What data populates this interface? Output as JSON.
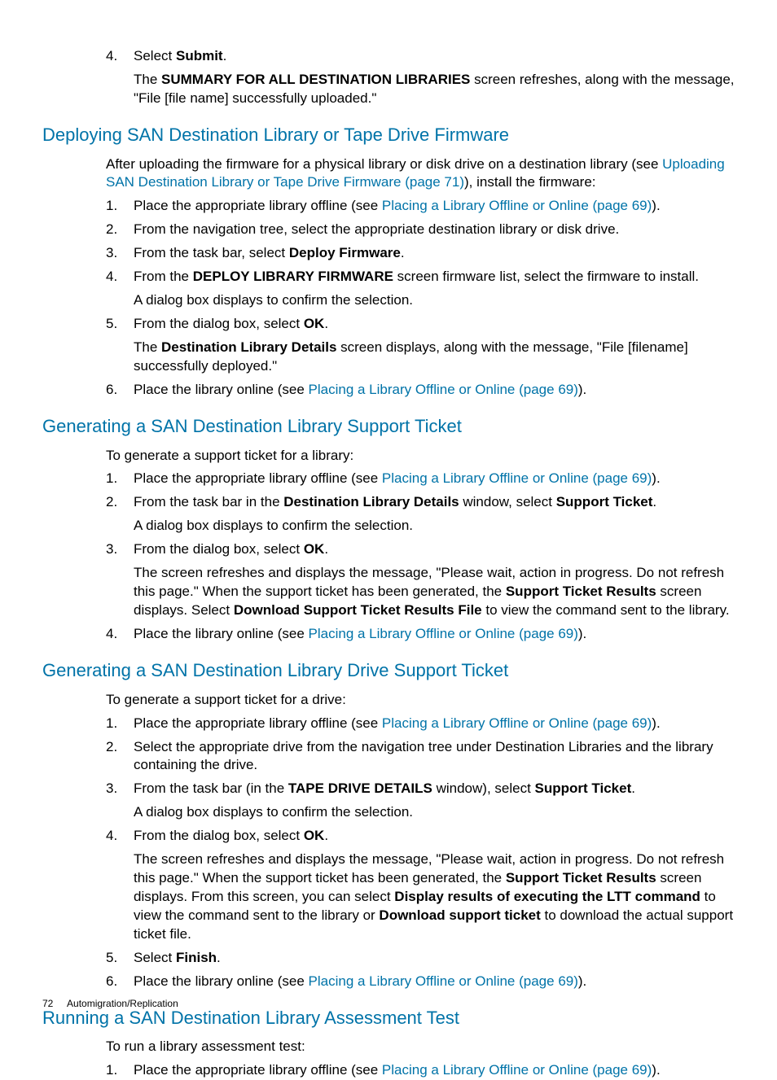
{
  "top_list": {
    "start": 4,
    "items": [
      {
        "text_parts": [
          "Select ",
          {
            "b": "Submit"
          },
          "."
        ],
        "sub": [
          "The ",
          {
            "b": "SUMMARY FOR ALL DESTINATION LIBRARIES"
          },
          " screen refreshes, along with the message, \"File [file name] successfully uploaded.\""
        ]
      }
    ]
  },
  "sections": [
    {
      "title": "Deploying SAN Destination Library or Tape Drive Firmware",
      "intro": [
        "After uploading the firmware for a physical library or disk drive on a destination library (see ",
        {
          "a": "Uploading SAN Destination Library or Tape Drive Firmware (page 71)"
        },
        "), install the firmware:"
      ],
      "items": [
        {
          "text_parts": [
            "Place the appropriate library offline (see ",
            {
              "a": "Placing a Library Offline or Online (page 69)"
            },
            ").",
            ""
          ]
        },
        {
          "text_parts": [
            "From the navigation tree, select the appropriate destination library or disk drive."
          ]
        },
        {
          "text_parts": [
            "From the task bar, select ",
            {
              "b": "Deploy Firmware"
            },
            "."
          ]
        },
        {
          "text_parts": [
            "From the ",
            {
              "b": "DEPLOY LIBRARY FIRMWARE"
            },
            " screen firmware list, select the firmware to install."
          ],
          "sub": [
            "A dialog box displays to confirm the selection."
          ]
        },
        {
          "text_parts": [
            "From the dialog box, select ",
            {
              "b": "OK"
            },
            "."
          ],
          "sub": [
            "The ",
            {
              "b": "Destination Library Details"
            },
            " screen displays, along with the message, \"File [filename] successfully deployed.\""
          ]
        },
        {
          "text_parts": [
            "Place the library online (see ",
            {
              "a": "Placing a Library Offline or Online (page 69)"
            },
            ").",
            ""
          ]
        }
      ]
    },
    {
      "title": "Generating a SAN Destination Library Support Ticket",
      "intro": [
        "To generate a support ticket for a library:"
      ],
      "items": [
        {
          "text_parts": [
            "Place the appropriate library offline (see ",
            {
              "a": "Placing a Library Offline or Online (page 69)"
            },
            ").",
            ""
          ]
        },
        {
          "text_parts": [
            "From the task bar in the ",
            {
              "b": "Destination Library Details"
            },
            " window, select ",
            {
              "b": "Support Ticket"
            },
            "."
          ],
          "sub": [
            "A dialog box displays to confirm the selection."
          ]
        },
        {
          "text_parts": [
            "From the dialog box, select ",
            {
              "b": "OK"
            },
            "."
          ],
          "sub": [
            "The screen refreshes and displays the message, \"Please wait, action in progress. Do not refresh this page.\" When the support ticket has been generated, the ",
            {
              "b": "Support Ticket Results"
            },
            " screen displays. Select ",
            {
              "b": "Download Support Ticket Results File"
            },
            " to view the command sent to the library."
          ]
        },
        {
          "text_parts": [
            "Place the library online (see ",
            {
              "a": "Placing a Library Offline or Online (page 69)"
            },
            ").",
            ""
          ]
        }
      ]
    },
    {
      "title": "Generating a SAN Destination Library Drive Support Ticket",
      "intro": [
        "To generate a support ticket for a drive:"
      ],
      "items": [
        {
          "text_parts": [
            "Place the appropriate library offline (see ",
            {
              "a": "Placing a Library Offline or Online (page 69)"
            },
            ").",
            ""
          ]
        },
        {
          "text_parts": [
            "Select the appropriate drive from the navigation tree under Destination Libraries and the library containing the drive."
          ]
        },
        {
          "text_parts": [
            "From the task bar (in the ",
            {
              "b": "TAPE DRIVE DETAILS"
            },
            " window), select ",
            {
              "b": "Support Ticket"
            },
            "."
          ],
          "sub": [
            "A dialog box displays to confirm the selection."
          ]
        },
        {
          "text_parts": [
            "From the dialog box, select ",
            {
              "b": "OK"
            },
            "."
          ],
          "sub": [
            "The screen refreshes and displays the message, \"Please wait, action in progress. Do not refresh this page.\" When the support ticket has been generated, the ",
            {
              "b": "Support Ticket Results"
            },
            " screen displays. From this screen, you can select ",
            {
              "b": "Display results of executing the LTT command"
            },
            " to view the command sent to the library or ",
            {
              "b": "Download support ticket"
            },
            " to download the actual support ticket file."
          ]
        },
        {
          "text_parts": [
            "Select ",
            {
              "b": "Finish"
            },
            "."
          ]
        },
        {
          "text_parts": [
            "Place the library online (see ",
            {
              "a": "Placing a Library Offline or Online (page 69)"
            },
            ").",
            ""
          ]
        }
      ]
    },
    {
      "title": "Running a SAN Destination Library Assessment Test",
      "intro": [
        "To run a library assessment test:"
      ],
      "items": [
        {
          "text_parts": [
            "Place the appropriate library offline (see ",
            {
              "a": "Placing a Library Offline or Online (page 69)"
            },
            ").",
            ""
          ]
        }
      ]
    }
  ],
  "footer": {
    "page": "72",
    "section": "Automigration/Replication"
  }
}
